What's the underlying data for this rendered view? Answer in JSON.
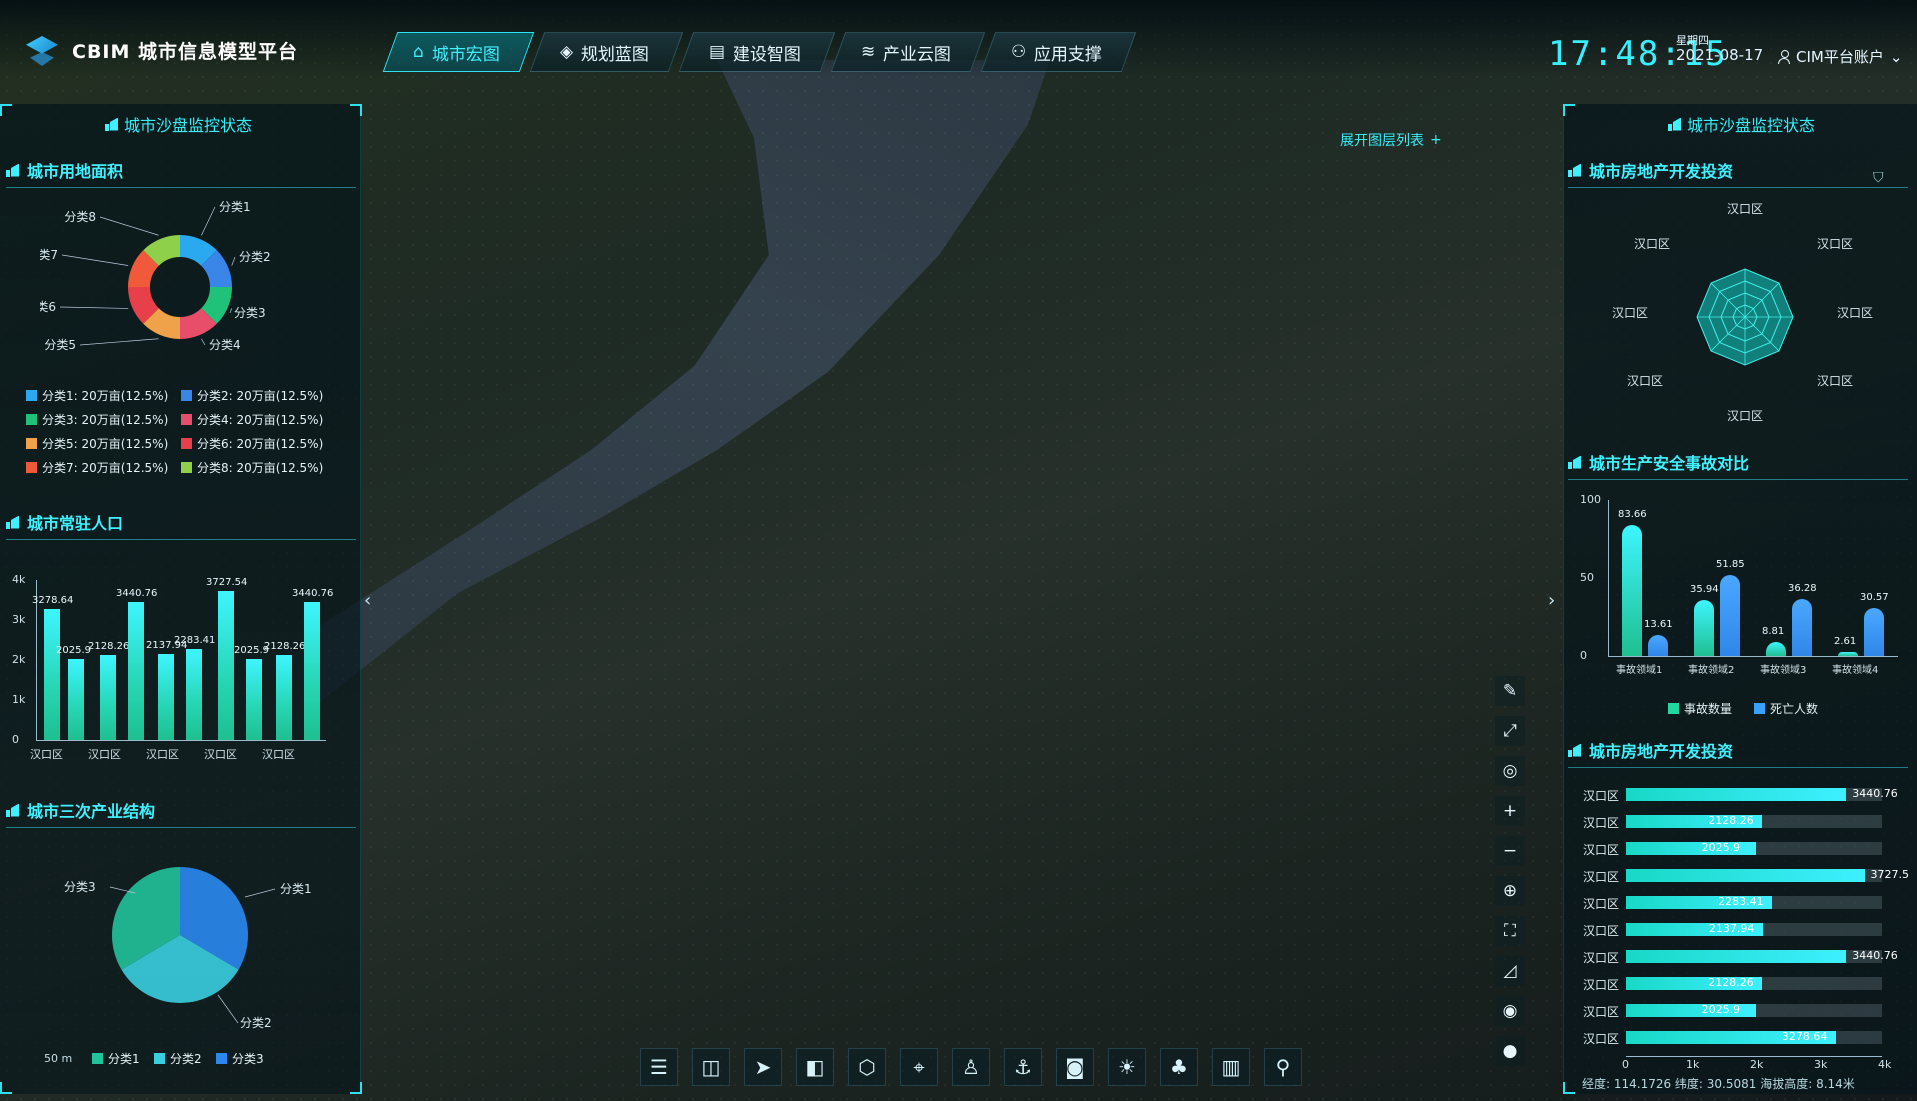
{
  "app": {
    "title": "CBIM 城市信息模型平台"
  },
  "nav": [
    {
      "icon": "home-icon",
      "label": "城市宏图",
      "active": true
    },
    {
      "icon": "cube-icon",
      "label": "规划蓝图"
    },
    {
      "icon": "building-icon",
      "label": "建设智图"
    },
    {
      "icon": "layers-icon",
      "label": "产业云图"
    },
    {
      "icon": "network-icon",
      "label": "应用支撑"
    }
  ],
  "header": {
    "time": "17:48:15",
    "weekday": "星期四",
    "date": "2021-08-17",
    "account": "CIM平台账户"
  },
  "left": {
    "panel_title": "城市沙盘监控状态",
    "land": {
      "title": "城市用地面积",
      "slices": [
        {
          "label": "分类1",
          "value": 20,
          "color": "#2ba9f0"
        },
        {
          "label": "分类2",
          "value": 20,
          "color": "#3a86e8"
        },
        {
          "label": "分类3",
          "value": 20,
          "color": "#20c27a"
        },
        {
          "label": "分类4",
          "value": 20,
          "color": "#e84d6a"
        },
        {
          "label": "分类5",
          "value": 20,
          "color": "#f0a24a"
        },
        {
          "label": "分类6",
          "value": 20,
          "color": "#e8404a"
        },
        {
          "label": "分类7",
          "value": 20,
          "color": "#f05a3a"
        },
        {
          "label": "分类8",
          "value": 20,
          "color": "#8fd04a"
        }
      ],
      "legend": [
        "分类1: 20万亩(12.5%)",
        "分类2: 20万亩(12.5%)",
        "分类3: 20万亩(12.5%)",
        "分类4: 20万亩(12.5%)",
        "分类5: 20万亩(12.5%)",
        "分类6: 20万亩(12.5%)",
        "分类7: 20万亩(12.5%)",
        "分类8: 20万亩(12.5%)"
      ]
    },
    "population": {
      "title": "城市常驻人口",
      "yticks": [
        "4k",
        "3k",
        "2k",
        "1k",
        "0"
      ],
      "xlabels": [
        "汉口区",
        "汉口区",
        "汉口区",
        "汉口区",
        "汉口区"
      ]
    },
    "industry": {
      "title": "城市三次产业结构",
      "labels": [
        "分类3",
        "分类1",
        "分类2"
      ],
      "legend": [
        "分类1",
        "分类2",
        "分类3"
      ],
      "colors": [
        "#22c29a",
        "#3acfe0",
        "#2a88f0"
      ]
    },
    "scale": "50 m"
  },
  "chart_data": [
    {
      "type": "bar",
      "title": "城市常驻人口",
      "values": [
        3278.64,
        2025.9,
        2128.26,
        3440.76,
        2137.94,
        2283.41,
        3727.54,
        2025.9,
        2128.26,
        3440.76
      ],
      "labels": [
        "3278.64",
        "2025.9",
        "2128.26",
        "3440.76",
        "2137.94",
        "2283.41",
        "3727.54",
        "2025.9",
        "2128.26",
        "3440.76"
      ],
      "ylim": [
        0,
        4000
      ]
    },
    {
      "type": "bar",
      "title": "城市生产安全事故对比",
      "categories": [
        "事故领域1",
        "事故领域2",
        "事故领域3",
        "事故领域4"
      ],
      "series": [
        {
          "name": "事故数量",
          "values": [
            83.66,
            35.94,
            8.81,
            2.61
          ]
        },
        {
          "name": "死亡人数",
          "values": [
            13.61,
            51.85,
            36.28,
            30.57
          ]
        }
      ],
      "yticks": [
        "100",
        "50",
        "0"
      ],
      "ylim": [
        0,
        100
      ]
    },
    {
      "type": "bar",
      "title": "城市房地产开发投资",
      "categories": [
        "汉口区",
        "汉口区",
        "汉口区",
        "汉口区",
        "汉口区",
        "汉口区",
        "汉口区",
        "汉口区",
        "汉口区",
        "汉口区"
      ],
      "values": [
        3440.76,
        2128.26,
        2025.9,
        3727.5,
        2283.41,
        2137.94,
        3440.76,
        2128.26,
        2025.9,
        3278.64
      ],
      "xticks": [
        "0",
        "1k",
        "2k",
        "3k",
        "4k"
      ],
      "xlim": [
        0,
        4000
      ]
    }
  ],
  "right": {
    "panel_title": "城市沙盘监控状态",
    "layers_button": "展开图层列表",
    "radar": {
      "title": "城市房地产开发投资",
      "labels": [
        "汉口区",
        "汉口区",
        "汉口区",
        "汉口区",
        "汉口区",
        "汉口区",
        "汉口区",
        "汉口区"
      ]
    },
    "accident": {
      "title": "城市生产安全事故对比",
      "legend": [
        "事故数量",
        "死亡人数"
      ]
    },
    "invest": {
      "title": "城市房地产开发投资"
    },
    "coords": "经度: 114.1726  纬度: 30.5081  海拔高度: 8.14米"
  },
  "toolbar": [
    "menu-icon",
    "split-icon",
    "pointer-icon",
    "compare-icon",
    "model-icon",
    "locate-icon",
    "person-icon",
    "anchor-icon",
    "camera-icon",
    "sun-icon",
    "tree-icon",
    "city-icon",
    "route-icon"
  ],
  "side_tools": [
    "pin-icon",
    "expand-icon",
    "compass-icon",
    "zoom-in-icon",
    "zoom-out-icon",
    "globe-icon",
    "fullscreen-icon",
    "measure-icon",
    "eye-icon",
    "earth-icon"
  ]
}
